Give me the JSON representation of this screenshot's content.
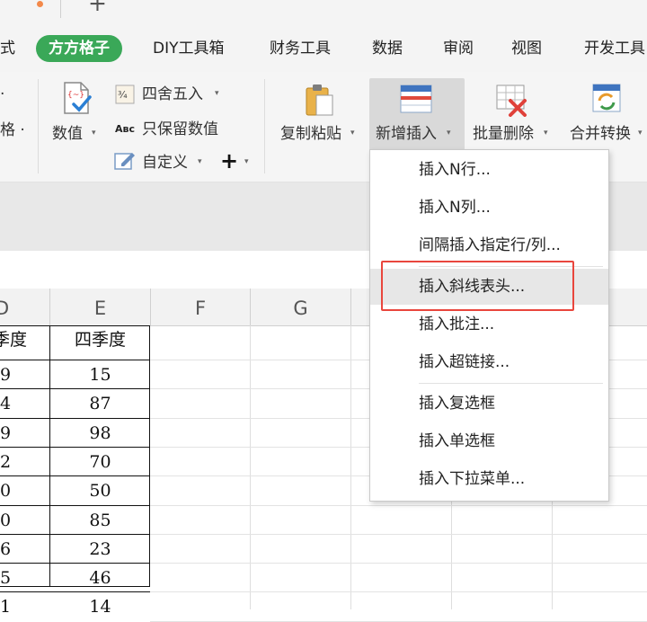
{
  "tab_strip": {
    "new_tab_glyph": "+"
  },
  "menu": {
    "items": [
      "式",
      "方方格子",
      "DIY工具箱",
      "财务工具",
      "数据",
      "审阅",
      "视图",
      "开发工具"
    ],
    "active_color": "#3aa858"
  },
  "ribbon": {
    "left_partial": [
      "·",
      "格 ·"
    ],
    "numeric_label": "数值",
    "round_label": "四舍五入",
    "keep_values_label": "只保留数值",
    "custom_label": "自定义",
    "plus_glyph": "+",
    "copy_paste_label": "复制粘贴",
    "new_insert_label": "新增插入",
    "batch_delete_label": "批量删除",
    "merge_convert_label": "合并转换"
  },
  "sheet": {
    "columns": [
      "D",
      "E",
      "F",
      "G"
    ],
    "header_row": [
      "季度",
      "四季度"
    ],
    "col_d_values": [
      "9",
      "4",
      "9",
      "2",
      "0",
      "0",
      "6",
      "5",
      "1"
    ],
    "col_e_values": [
      "15",
      "87",
      "98",
      "70",
      "50",
      "85",
      "23",
      "46",
      "14"
    ]
  },
  "dropdown": {
    "items": [
      "插入N行...",
      "插入N列...",
      "间隔插入指定行/列...",
      "插入斜线表头...",
      "插入批注...",
      "插入超链接...",
      "插入复选框",
      "插入单选框",
      "插入下拉菜单..."
    ],
    "highlight_color": "#e9463d"
  }
}
